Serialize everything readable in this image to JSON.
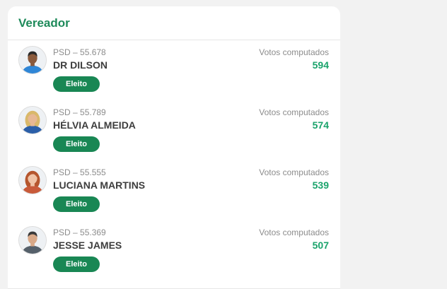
{
  "section": {
    "title": "Vereador"
  },
  "colors": {
    "accent": "#1e8a5a",
    "badge": "#198754",
    "votes": "#1aa36b"
  },
  "candidates": [
    {
      "meta": "PSD – 55.678",
      "name": "DR DILSON",
      "badge": "Eleito",
      "votes_label": "Votos computados",
      "votes": "594",
      "avatar": "man-blue-shirt",
      "shirt": "#2f86d6",
      "hair": "#2a2a2a",
      "skin": "#8a5a3c"
    },
    {
      "meta": "PSD – 55.789",
      "name": "HÉLVIA ALMEIDA",
      "badge": "Eleito",
      "votes_label": "Votos computados",
      "votes": "574",
      "avatar": "woman-blonde",
      "shirt": "#2b5fa8",
      "hair": "#d9b86a",
      "skin": "#e7b894"
    },
    {
      "meta": "PSD – 55.555",
      "name": "LUCIANA MARTINS",
      "badge": "Eleito",
      "votes_label": "Votos computados",
      "votes": "539",
      "avatar": "woman-red-hair",
      "shirt": "#c85a3a",
      "hair": "#b5562e",
      "skin": "#f0c4a8"
    },
    {
      "meta": "PSD – 55.369",
      "name": "JESSE JAMES",
      "badge": "Eleito",
      "votes_label": "Votos computados",
      "votes": "507",
      "avatar": "man-gray-shirt",
      "shirt": "#55606a",
      "hair": "#3a3a3a",
      "skin": "#d9a988"
    }
  ]
}
